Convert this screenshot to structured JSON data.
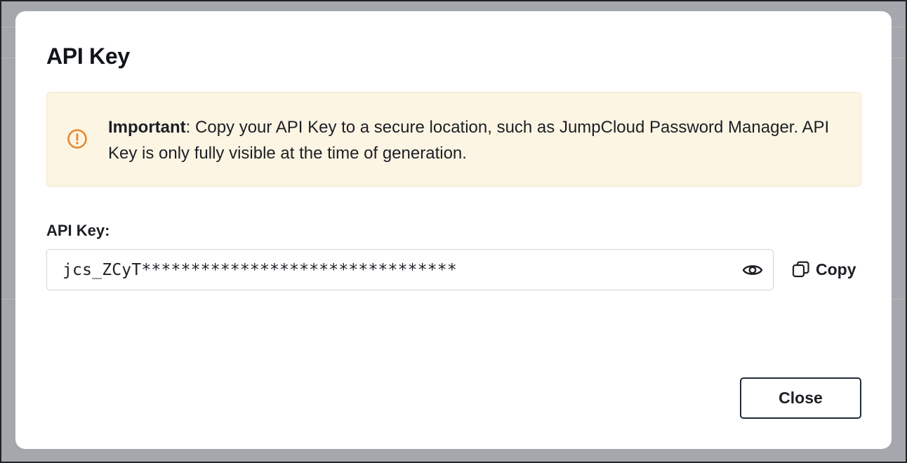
{
  "modal": {
    "title": "API Key",
    "alert": {
      "icon": "exclamation-circle-icon",
      "bold_prefix": "Important",
      "message": ": Copy your API Key to a secure location, such as JumpCloud Password Manager. API Key is only fully visible at the time of generation.",
      "accent_color": "#e8882f",
      "background_color": "#fdf5e4"
    },
    "field": {
      "label": "API Key:",
      "value": "jcs_ZCyT********************************",
      "reveal_icon": "eye-icon"
    },
    "copy": {
      "icon": "copy-icon",
      "label": "Copy"
    },
    "footer": {
      "close_label": "Close"
    }
  }
}
